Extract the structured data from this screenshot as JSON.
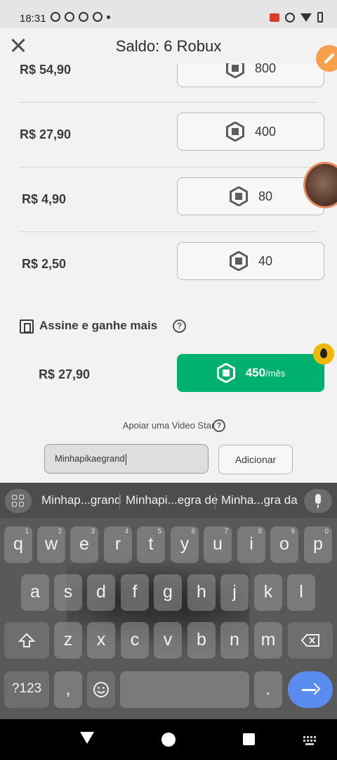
{
  "status_bar": {
    "time": "18:31"
  },
  "header": {
    "title": "Saldo: 6 Robux"
  },
  "packages": [
    {
      "price": "R$ 54,90",
      "amount": "800"
    },
    {
      "price": "R$ 27,90",
      "amount": "400"
    },
    {
      "price": "R$ 4,90",
      "amount": "80"
    },
    {
      "price": "R$ 2,50",
      "amount": "40"
    }
  ],
  "subscription": {
    "title": "Assine e ganhe mais",
    "help": "?",
    "price": "R$ 27,90",
    "amount": "450",
    "period": "/mês"
  },
  "support": {
    "label": "Apoiar uma Video Star",
    "help": "?",
    "input_value": "Minhapikaegrand",
    "add_label": "Adicionar"
  },
  "keyboard": {
    "suggestions": [
      "Minhap...grand",
      "Minhapi...egra de",
      "Minha...gra da"
    ],
    "row1": [
      {
        "k": "q",
        "n": "1"
      },
      {
        "k": "w",
        "n": "2"
      },
      {
        "k": "e",
        "n": "3"
      },
      {
        "k": "r",
        "n": "4"
      },
      {
        "k": "t",
        "n": "5"
      },
      {
        "k": "y",
        "n": "6"
      },
      {
        "k": "u",
        "n": "7"
      },
      {
        "k": "i",
        "n": "8"
      },
      {
        "k": "o",
        "n": "9"
      },
      {
        "k": "p",
        "n": "0"
      }
    ],
    "row2": [
      "a",
      "s",
      "d",
      "f",
      "g",
      "h",
      "j",
      "k",
      "l"
    ],
    "row3": [
      "z",
      "x",
      "c",
      "v",
      "b",
      "n",
      "m"
    ],
    "symbols_label": "?123",
    "comma": ",",
    "period": "."
  },
  "colors": {
    "accent_green": "#00b06f",
    "fab_orange": "#f6a04d",
    "enter_blue": "#5a8cf0"
  }
}
